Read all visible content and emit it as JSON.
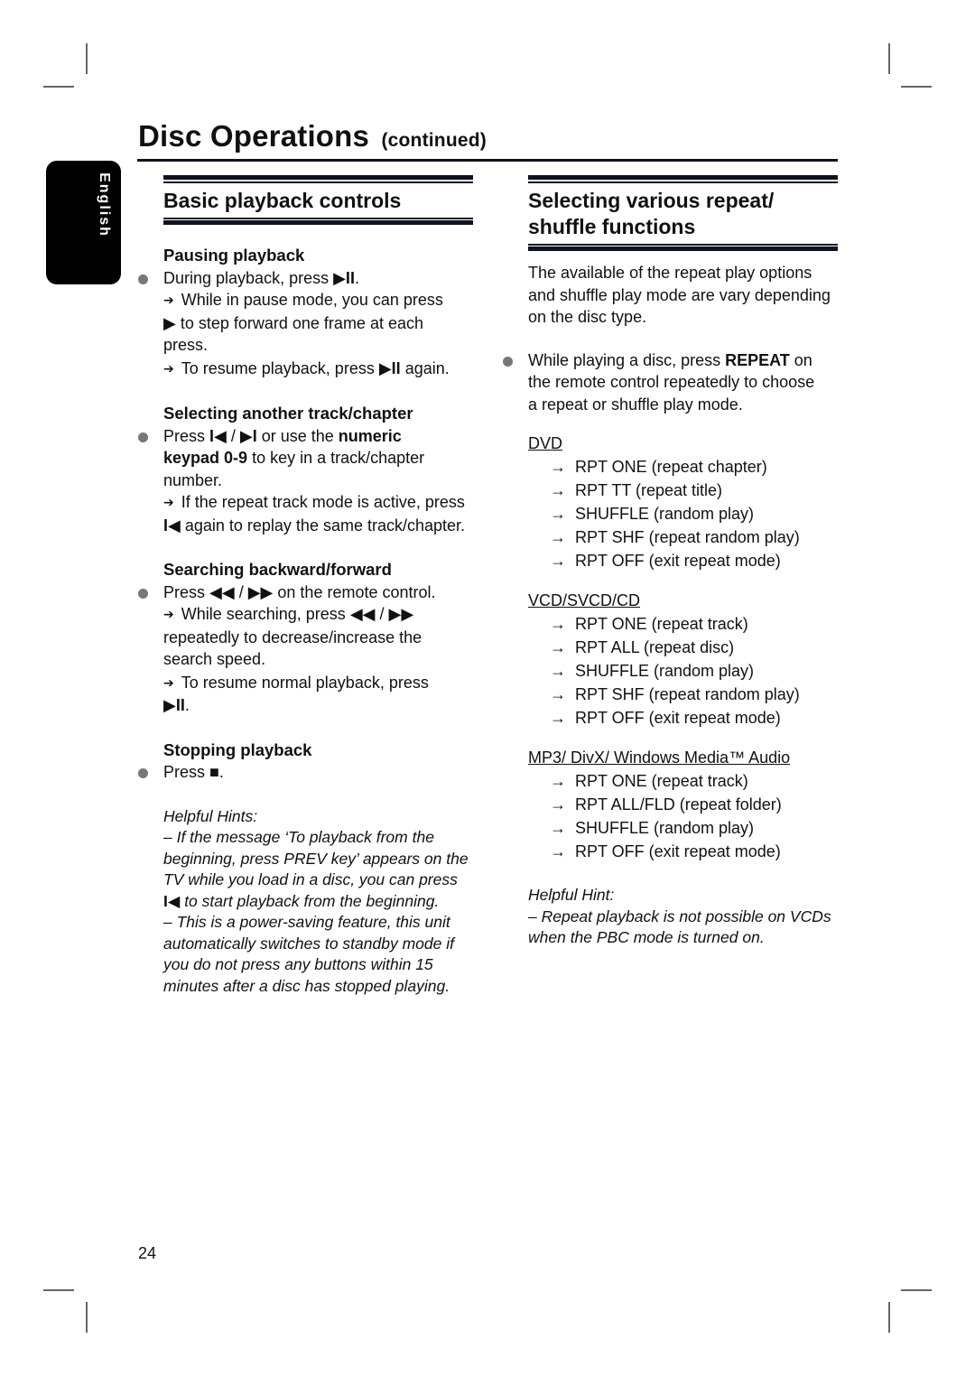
{
  "page": {
    "title": "Disc Operations",
    "title_suffix": "(continued)",
    "language_tab": "English",
    "page_number": "24"
  },
  "left": {
    "heading": "Basic playback controls",
    "pausing": {
      "title": "Pausing playback",
      "bullet_pre": "During playback, press ",
      "bullet_icon": "▶II",
      "bullet_post": ".",
      "arrow1_line1": "While in pause mode, you can press",
      "arrow1_icon": "▶",
      "arrow1_rest": " to step forward one frame at each",
      "arrow1_line3": "press.",
      "arrow2_pre": "To resume playback, press ",
      "arrow2_icon": "▶II",
      "arrow2_post": " again."
    },
    "track": {
      "title": "Selecting another track/chapter",
      "bullet_pre": "Press ",
      "prev_icon": "I◀",
      "sep": " / ",
      "next_icon": "▶I",
      "bullet_mid": " or use the ",
      "bullet_bold1": "numeric",
      "bullet_bold2": "keypad 0-9",
      "bullet_post": " to key in a track/chapter",
      "bullet_line3": "number.",
      "arrow_line1": "If the repeat track mode is active, press",
      "arrow_icon": "I◀",
      "arrow_line2": " again to replay the same track/chapter."
    },
    "search": {
      "title": "Searching backward/forward",
      "bullet_pre": "Press ",
      "rew_icon": "◀◀",
      "sep": " / ",
      "ff_icon": "▶▶",
      "bullet_post": " on the remote control.",
      "arrow1_pre": "While searching, press ",
      "arrow1_line2": "repeatedly to decrease/increase the",
      "arrow1_line3": "search speed.",
      "arrow2_line1": "To resume normal playback, press",
      "arrow2_icon": "▶II",
      "arrow2_post": "."
    },
    "stop": {
      "title": "Stopping playback",
      "bullet_pre": "Press ",
      "stop_icon": "■",
      "bullet_post": "."
    },
    "hints": {
      "title": "Helpful Hints:",
      "line1": "–  If the message ‘To playback from the",
      "line2": "beginning, press PREV key’ appears on the",
      "line3": "TV while you load in a disc, you can press",
      "line4_icon": "I◀",
      "line4": " to start playback from the beginning.",
      "line5": "–  This is a power-saving feature, this unit",
      "line6": "automatically switches to standby mode if",
      "line7": "you do not press any buttons within 15",
      "line8": "minutes after a disc has stopped playing."
    }
  },
  "right": {
    "heading_line1": "Selecting various repeat/",
    "heading_line2": "shuffle functions",
    "intro_line1": "The available of the repeat play options",
    "intro_line2": "and shuffle play mode are vary depending",
    "intro_line3": "on the disc type.",
    "bullet_pre": "While playing a disc, press ",
    "bullet_bold": "REPEAT",
    "bullet_post": " on",
    "bullet_line2": "the remote control repeatedly to choose",
    "bullet_line3": "a repeat or shuffle play mode.",
    "groups": [
      {
        "name": "DVD",
        "options": [
          "RPT ONE (repeat chapter)",
          "RPT TT (repeat title)",
          "SHUFFLE (random play)",
          "RPT SHF (repeat random play)",
          "RPT OFF (exit repeat mode)"
        ]
      },
      {
        "name": "VCD/SVCD/CD",
        "options": [
          "RPT ONE (repeat track)",
          "RPT ALL (repeat disc)",
          "SHUFFLE (random play)",
          "RPT SHF (repeat random play)",
          "RPT OFF (exit repeat mode)"
        ]
      },
      {
        "name": "MP3/ DivX/ Windows Media™ Audio",
        "options": [
          "RPT ONE (repeat track)",
          "RPT ALL/FLD (repeat folder)",
          "SHUFFLE (random play)",
          "RPT OFF (exit repeat mode)"
        ]
      }
    ],
    "hint_title": "Helpful Hint:",
    "hint_line1": "–  Repeat playback is not possible on VCDs",
    "hint_line2": "when the PBC mode is turned on."
  }
}
